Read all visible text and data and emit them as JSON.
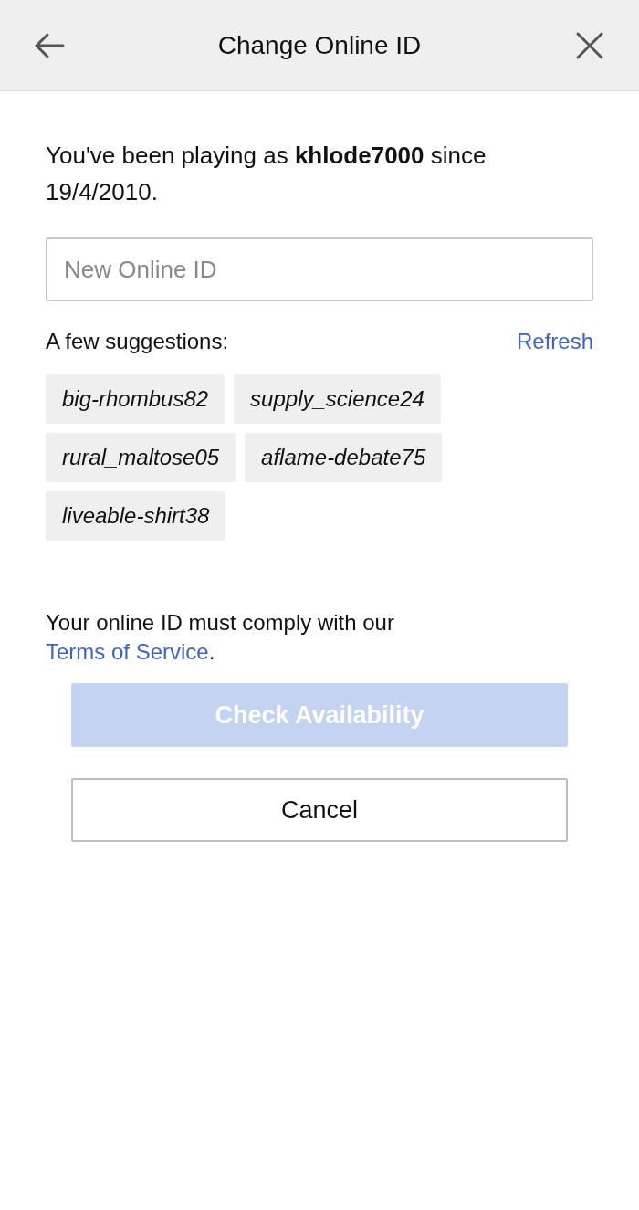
{
  "header": {
    "title": "Change Online ID"
  },
  "intro": "You've been playing as **khlode7000** since 19/4/2010.",
  "field": {
    "placeholder": "New Online ID"
  },
  "suggestions": {
    "label": "A few suggestions:",
    "refresh": "Refresh",
    "items": [
      "big-rhombus82",
      "supply_science24",
      "rural_maltose05",
      "aflame-debate75",
      "liveable-shirt38"
    ]
  },
  "terms": {
    "text": "Your online ID must comply with our",
    "link": "Terms of Service",
    "end": "."
  },
  "check_button": {
    "label": "Check Availability",
    "disabled": true
  },
  "cancel_button": {
    "label": "Cancel"
  }
}
